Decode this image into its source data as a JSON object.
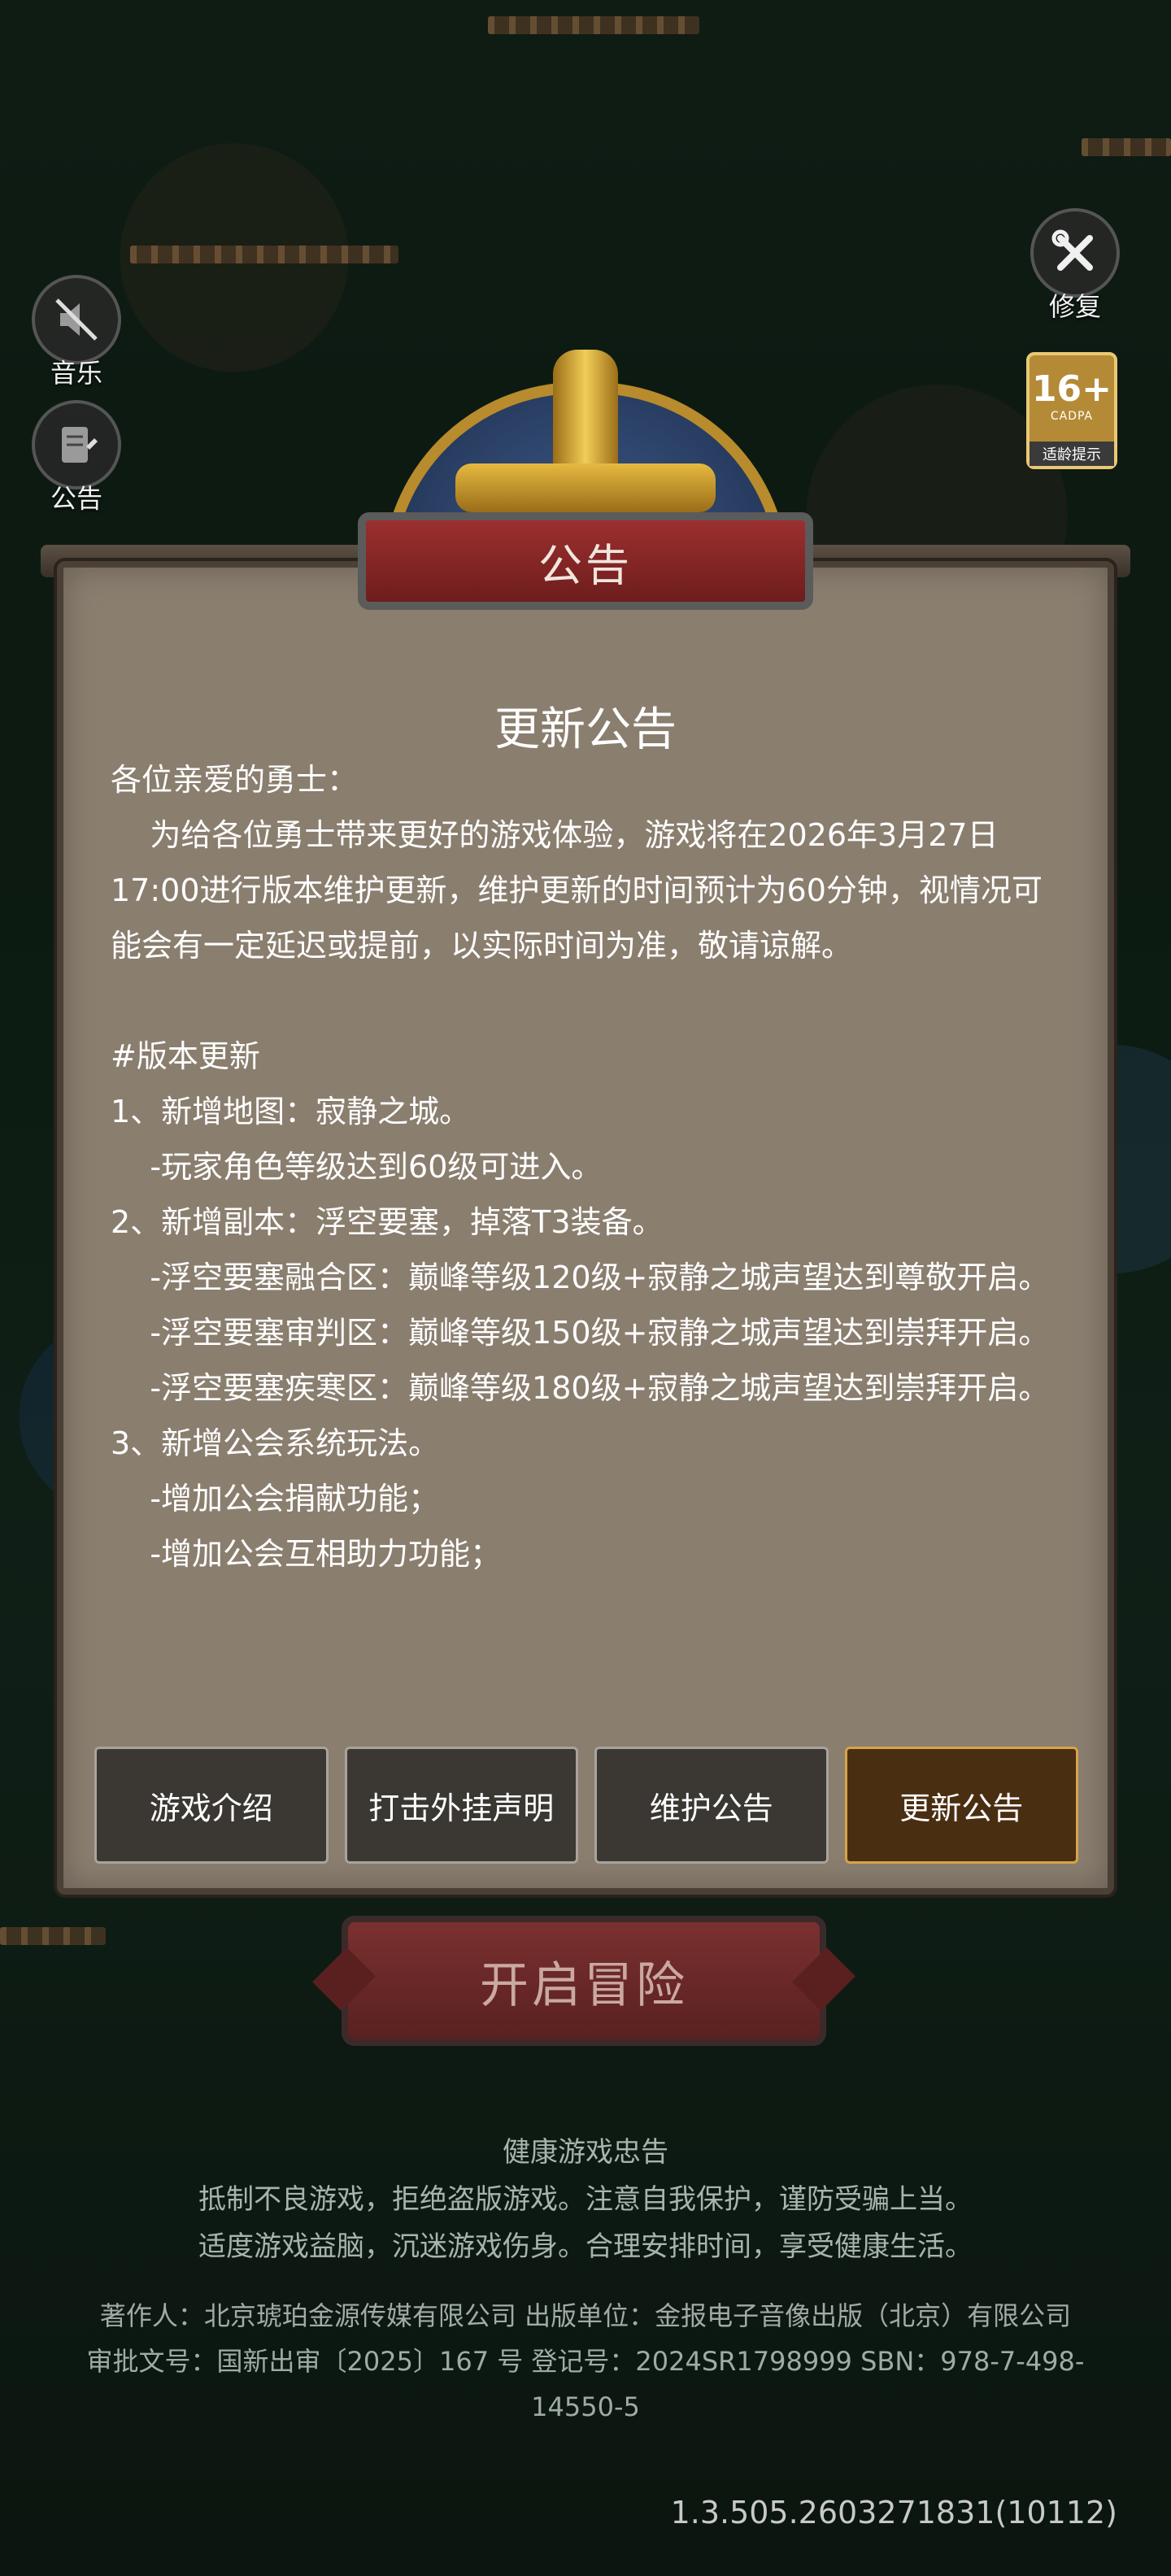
{
  "side": {
    "music_label": "音乐",
    "notice_label": "公告",
    "repair_label": "修复"
  },
  "age_rating": {
    "number": "16+",
    "org": "CADPA",
    "tip": "适龄提示"
  },
  "panel": {
    "title": "公告",
    "heading": "更新公告",
    "lines": [
      "各位亲爱的勇士：",
      "    为给各位勇士带来更好的游戏体验，游戏将在2026年3月27日17:00进行版本维护更新，维护更新的时间预计为60分钟，视情况可能会有一定延迟或提前，以实际时间为准，敬请谅解。",
      "",
      "#版本更新",
      "1、新增地图：寂静之城。",
      "    -玩家角色等级达到60级可进入。",
      "2、新增副本：浮空要塞，掉落T3装备。",
      "    -浮空要塞融合区：巅峰等级120级+寂静之城声望达到尊敬开启。",
      "    -浮空要塞审判区：巅峰等级150级+寂静之城声望达到崇拜开启。",
      "    -浮空要塞疾寒区：巅峰等级180级+寂静之城声望达到崇拜开启。",
      "3、新增公会系统玩法。",
      "    -增加公会捐献功能；",
      "    -增加公会互相助力功能；"
    ]
  },
  "tabs": [
    {
      "label": "游戏介绍",
      "active": false
    },
    {
      "label": "打击外挂声明",
      "active": false
    },
    {
      "label": "维护公告",
      "active": false
    },
    {
      "label": "更新公告",
      "active": true
    }
  ],
  "start_button": "开启冒险",
  "health": {
    "title": "健康游戏忠告",
    "line1": "抵制不良游戏，拒绝盗版游戏。注意自我保护，谨防受骗上当。",
    "line2": "适度游戏益脑，沉迷游戏伤身。合理安排时间，享受健康生活。"
  },
  "credits": {
    "line1": "著作人：北京琥珀金源传媒有限公司  出版单位：金报电子音像出版（北京）有限公司",
    "line2": "审批文号：国新出审〔2025〕167 号  登记号：2024SR1798999  SBN：978-7-498-",
    "line3": "14550-5"
  },
  "version": "1.3.505.2603271831(10112)"
}
